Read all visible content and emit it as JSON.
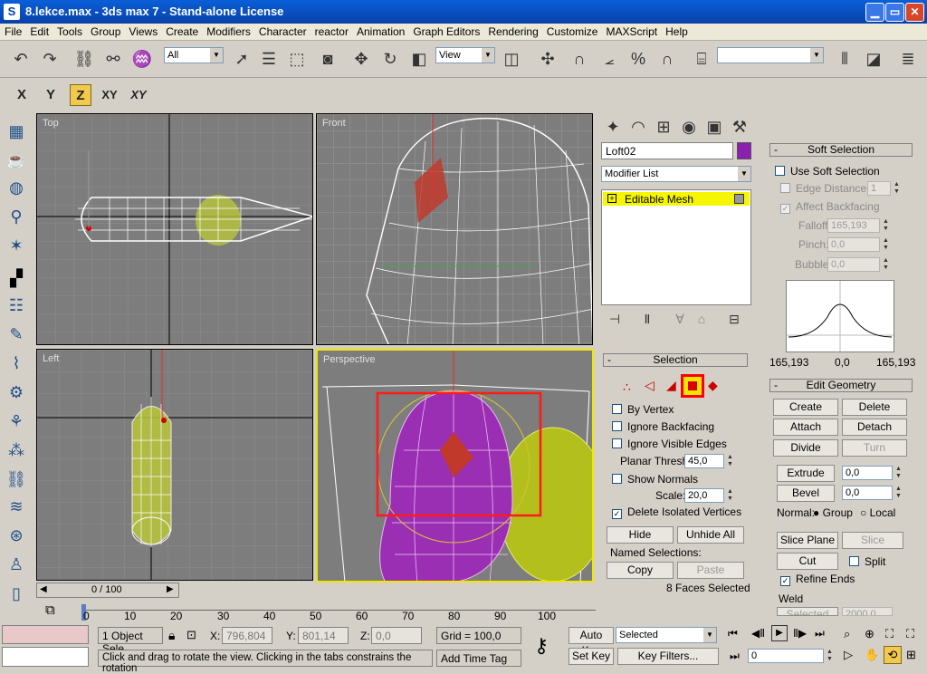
{
  "window": {
    "title": "8.lekce.max - 3ds max 7  - Stand-alone License",
    "min": "▁",
    "max": "▭",
    "close": "✕"
  },
  "menu": [
    "File",
    "Edit",
    "Tools",
    "Group",
    "Views",
    "Create",
    "Modifiers",
    "Character",
    "reactor",
    "Animation",
    "Graph Editors",
    "Rendering",
    "Customize",
    "MAXScript",
    "Help"
  ],
  "toolbar": {
    "selection_filter": "All",
    "ref_coord": "View",
    "named_sel": ""
  },
  "axis": {
    "x": "X",
    "y": "Y",
    "z": "Z",
    "xy": "XY",
    "xy2": "XY"
  },
  "viewports": {
    "top": "Top",
    "front": "Front",
    "left": "Left",
    "perspective": "Perspective"
  },
  "command_panel": {
    "object_name": "Loft02",
    "object_color": "#8a1fb0",
    "modifier_list": "Modifier List",
    "stack_item": "Editable Mesh"
  },
  "selection": {
    "header": "Selection",
    "by_vertex": "By Vertex",
    "ignore_backfacing": "Ignore Backfacing",
    "ignore_visible_edges": "Ignore Visible Edges",
    "planar_thresh_label": "Planar Thresh:",
    "planar_thresh": "45,0",
    "show_normals": "Show Normals",
    "scale_label": "Scale:",
    "scale": "20,0",
    "delete_isolated": "Delete Isolated Vertices",
    "hide": "Hide",
    "unhide_all": "Unhide All",
    "named_selections": "Named Selections:",
    "copy": "Copy",
    "paste": "Paste",
    "status": "8 Faces Selected"
  },
  "soft_selection": {
    "header": "Soft Selection",
    "use_soft": "Use Soft Selection",
    "edge_distance": "Edge Distance:",
    "edge_distance_val": "1",
    "affect_backfacing": "Affect Backfacing",
    "falloff": "Falloff:",
    "falloff_val": "165,193",
    "pinch": "Pinch:",
    "pinch_val": "0,0",
    "bubble": "Bubble:",
    "bubble_val": "0,0",
    "curve_left": "165,193",
    "curve_mid": "0,0",
    "curve_right": "165,193"
  },
  "edit_geometry": {
    "header": "Edit Geometry",
    "create": "Create",
    "delete": "Delete",
    "attach": "Attach",
    "detach": "Detach",
    "divide": "Divide",
    "turn": "Turn",
    "extrude": "Extrude",
    "extrude_val": "0,0",
    "bevel": "Bevel",
    "bevel_val": "0,0",
    "normal_label": "Normal:",
    "group": "Group",
    "local": "Local",
    "slice_plane": "Slice Plane",
    "slice": "Slice",
    "cut": "Cut",
    "split": "Split",
    "refine_ends": "Refine Ends",
    "weld": "Weld",
    "selected": "Selected",
    "selected_val": "2000,0"
  },
  "timeline": {
    "frame": "0 / 100",
    "ticks": [
      "0",
      "10",
      "20",
      "30",
      "40",
      "50",
      "60",
      "70",
      "80",
      "90",
      "100"
    ]
  },
  "status": {
    "objects": "1 Object Sele",
    "x_label": "X:",
    "x": "796,804",
    "y_label": "Y:",
    "y": "801,14",
    "z_label": "Z:",
    "z": "0,0",
    "grid": "Grid = 100,0",
    "hint": "Click and drag to rotate the view.  Clicking in the tabs constrains the rotation",
    "add_time_tag": "Add Time Tag",
    "auto_key": "Auto Key",
    "set_key": "Set Key",
    "key_mode": "Selected",
    "key_filters": "Key Filters...",
    "current_frame": "0"
  }
}
